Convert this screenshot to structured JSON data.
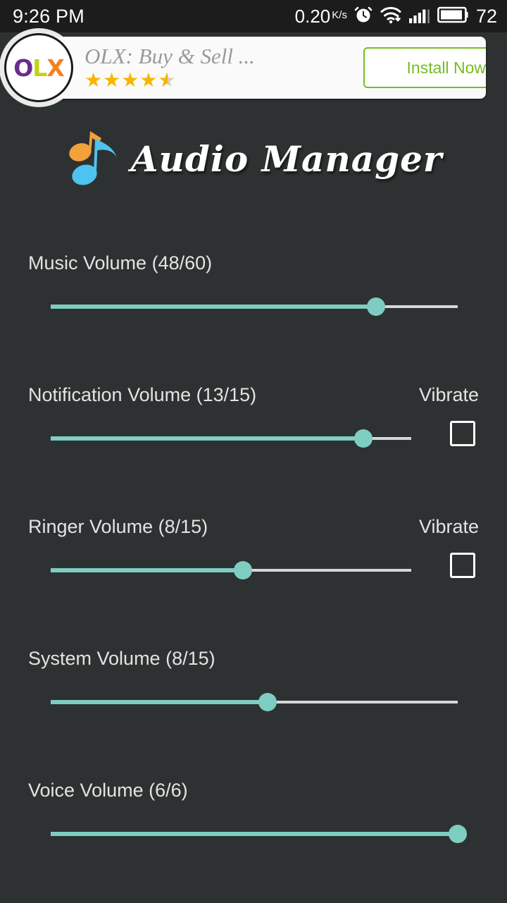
{
  "status_bar": {
    "clock": "9:26 PM",
    "net_speed_value": "0.20",
    "net_speed_unit": "K/s",
    "icons": [
      "alarm-clock-icon",
      "wifi-download-icon",
      "signal-bars-icon",
      "battery-icon"
    ],
    "battery_level": "72"
  },
  "ad": {
    "logo_o": "O",
    "logo_l": "L",
    "logo_x": "X",
    "title": "OLX: Buy & Sell ...",
    "rating": 4.5,
    "stars_full": "★★★★",
    "star_half": "★",
    "cta_label": "Install Now",
    "cta_color": "#76bc21"
  },
  "app": {
    "title": "Audio Manager",
    "logo_icon": "music-note-icon",
    "note_color_primary": "#4ec3ef",
    "note_color_secondary": "#f2a13b"
  },
  "theme": {
    "background": "#2e3131",
    "accent": "#7ecdc2",
    "track_inactive": "#d6d6d6",
    "text": "#e3e3e3"
  },
  "volume_rows": [
    {
      "id": "music",
      "label": "Music Volume (48/60)",
      "value": 48,
      "max": 60,
      "percent": 80,
      "has_vibrate": false,
      "vibrate_label": "",
      "vibrate_checked": false,
      "slider_width": 578
    },
    {
      "id": "notification",
      "label": "Notification Volume (13/15)",
      "value": 13,
      "max": 15,
      "percent": 86.7,
      "has_vibrate": true,
      "vibrate_label": "Vibrate",
      "vibrate_checked": false,
      "slider_width": 512
    },
    {
      "id": "ringer",
      "label": "Ringer Volume (8/15)",
      "value": 8,
      "max": 15,
      "percent": 53.3,
      "has_vibrate": true,
      "vibrate_label": "Vibrate",
      "vibrate_checked": false,
      "slider_width": 512
    },
    {
      "id": "system",
      "label": "System Volume (8/15)",
      "value": 8,
      "max": 15,
      "percent": 53.3,
      "has_vibrate": false,
      "vibrate_label": "",
      "vibrate_checked": false,
      "slider_width": 578
    },
    {
      "id": "voice",
      "label": "Voice Volume (6/6)",
      "value": 6,
      "max": 6,
      "percent": 100,
      "has_vibrate": false,
      "vibrate_label": "",
      "vibrate_checked": false,
      "slider_width": 578
    }
  ]
}
